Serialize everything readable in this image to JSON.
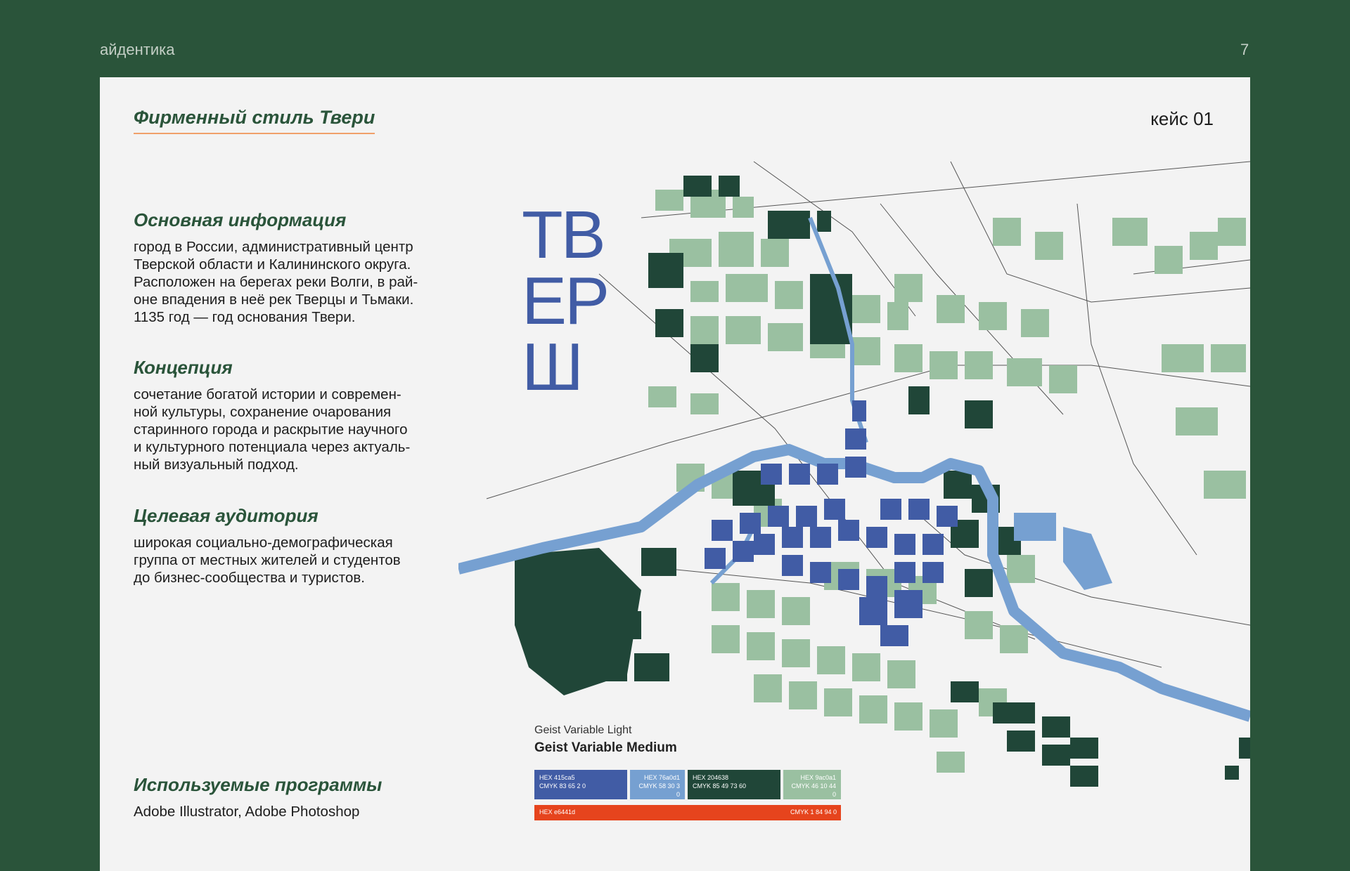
{
  "header": {
    "label": "айдентика",
    "page": "7"
  },
  "card": {
    "title": "Фирменный стиль Твери",
    "case": "кейс 01",
    "sections": [
      {
        "heading": "Основная информация",
        "text": "город в России, административный центр\nТверской области и Калининского округа.\nРасположен на берегах реки Волги, в рай-\nоне впадения в неё рек Тверцы и Тьмаки.\n1135 год — год основания Твери."
      },
      {
        "heading": "Концепция",
        "text": "сочетание богатой истории и современ-\nной культуры, сохранение очарования\nстаринного города и раскрытие научного\nи культурного потенциала через актуаль-\nный визуальный подход."
      },
      {
        "heading": "Целевая аудитория",
        "text": "широкая социально-демографическая\nгруппа от местных жителей и студентов\nдо бизнес-сообщества и туристов."
      },
      {
        "heading": "Используемые программы",
        "text": "Adobe Illustrator, Adobe Photoshop"
      }
    ],
    "logo_lines": [
      "ТВ",
      "ЕР",
      "Ш"
    ],
    "fonts": {
      "light": "Geist Variable Light",
      "medium": "Geist Variable Medium"
    },
    "palette": [
      {
        "hex": "HEX 415ca5",
        "cmyk": "CMYK 83 65 2 0",
        "color": "#415ca5"
      },
      {
        "hex": "HEX 76a0d1",
        "cmyk": "CMYK 58 30 3 0",
        "color": "#76a0d1"
      },
      {
        "hex": "HEX 204638",
        "cmyk": "CMYK 85 49 73 60",
        "color": "#204638"
      },
      {
        "hex": "HEX 9ac0a1",
        "cmyk": "CMYK 46 10 44 0",
        "color": "#9ac0a1"
      }
    ],
    "accent": {
      "hex": "HEX e6441d",
      "cmyk": "CMYK 1 84 94 0",
      "color": "#e6441d"
    }
  }
}
